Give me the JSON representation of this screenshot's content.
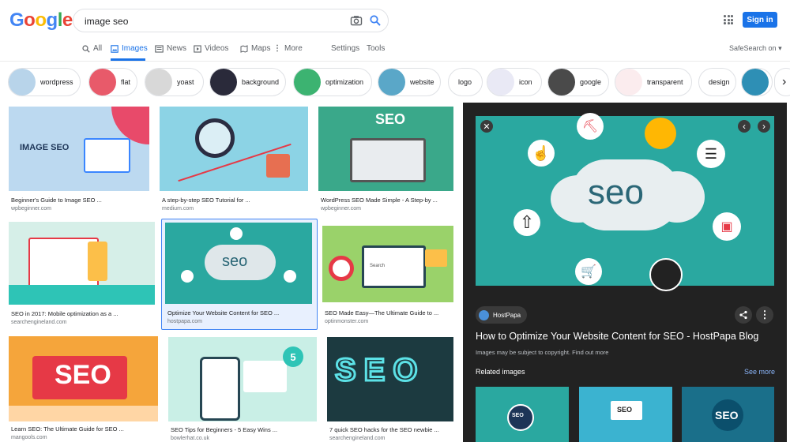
{
  "header": {
    "logo": [
      "G",
      "o",
      "o",
      "g",
      "l",
      "e"
    ],
    "logo_colors": [
      "#4285f4",
      "#ea4335",
      "#fbbc05",
      "#4285f4",
      "#34a853",
      "#ea4335"
    ],
    "search_value": "image seo",
    "signin": "Sign in"
  },
  "tabs": {
    "all": "All",
    "images": "Images",
    "news": "News",
    "videos": "Videos",
    "maps": "Maps",
    "more": "More",
    "settings": "Settings",
    "tools": "Tools",
    "safesearch": "SafeSearch on"
  },
  "chips": [
    {
      "label": "wordpress",
      "color": "#b8d4ea"
    },
    {
      "label": "flat",
      "color": "#e85a6a"
    },
    {
      "label": "yoast",
      "color": "#d8d8d8"
    },
    {
      "label": "background",
      "color": "#2a2a3a"
    },
    {
      "label": "optimization",
      "color": "#3cb371"
    },
    {
      "label": "website",
      "color": "#5aa7c8"
    },
    {
      "label": "logo",
      "color": ""
    },
    {
      "label": "icon",
      "color": "#e9e9f5"
    },
    {
      "label": "google",
      "color": "#4a4a4a"
    },
    {
      "label": "transparent",
      "color": "#fbecee"
    },
    {
      "label": "design",
      "color": ""
    },
    {
      "label": "",
      "color": "#2e8fb5"
    }
  ],
  "results": [
    {
      "title": "Beginner's Guide to Image SEO ...",
      "source": "wpbeginner.com",
      "bg": "#bcd9f0",
      "thumb_text": "IMAGE SEO"
    },
    {
      "title": "A step-by-step SEO Tutorial for ...",
      "source": "medium.com",
      "bg": "#8cd3e5",
      "thumb_text": ""
    },
    {
      "title": "WordPress SEO Made Simple - A Step-by ...",
      "source": "wpbeginner.com",
      "bg": "#3aa88a",
      "thumb_text": "SEO"
    },
    {
      "title": "SEO in 2017: Mobile optimization as a ...",
      "source": "searchengineland.com",
      "bg": "#d6efe8",
      "thumb_text": ""
    },
    {
      "title": "Optimize Your Website Content for SEO ...",
      "source": "hostpapa.com",
      "bg": "#2aa8a0",
      "thumb_text": "seo"
    },
    {
      "title": "SEO Made Easy—The Ultimate Guide to ...",
      "source": "optinmonster.com",
      "bg": "#9ad26a",
      "thumb_text": "Search"
    },
    {
      "title": "Learn SEO: The Ultimate Guide for SEO ...",
      "source": "mangools.com",
      "bg": "#f5a53b",
      "thumb_text": "SEO"
    },
    {
      "title": "SEO Tips for Beginners - 5 Easy Wins ...",
      "source": "bowlerhat.co.uk",
      "bg": "#c9efe6",
      "thumb_text": "5"
    },
    {
      "title": "7 quick SEO hacks for the SEO newbie ...",
      "source": "searchengineland.com",
      "bg": "#1c3a40",
      "thumb_text": "SEO"
    }
  ],
  "panel": {
    "image_text": "seo",
    "source_name": "HostPapa",
    "title": "How to Optimize Your Website Content for SEO - HostPapa Blog",
    "copyright": "Images may be subject to copyright.",
    "find_out_more": "Find out more",
    "related_heading": "Related images",
    "see_more": "See more",
    "related": [
      {
        "bg": "#2aa8a0",
        "text": "SEO"
      },
      {
        "bg": "#3bb3d0",
        "text": "SEO"
      },
      {
        "bg": "#1a6f8a",
        "text": "SEO"
      }
    ]
  },
  "colors": {
    "accent": "#1a73e8",
    "panel_bg": "#222222",
    "link": "#8ab4f8"
  }
}
